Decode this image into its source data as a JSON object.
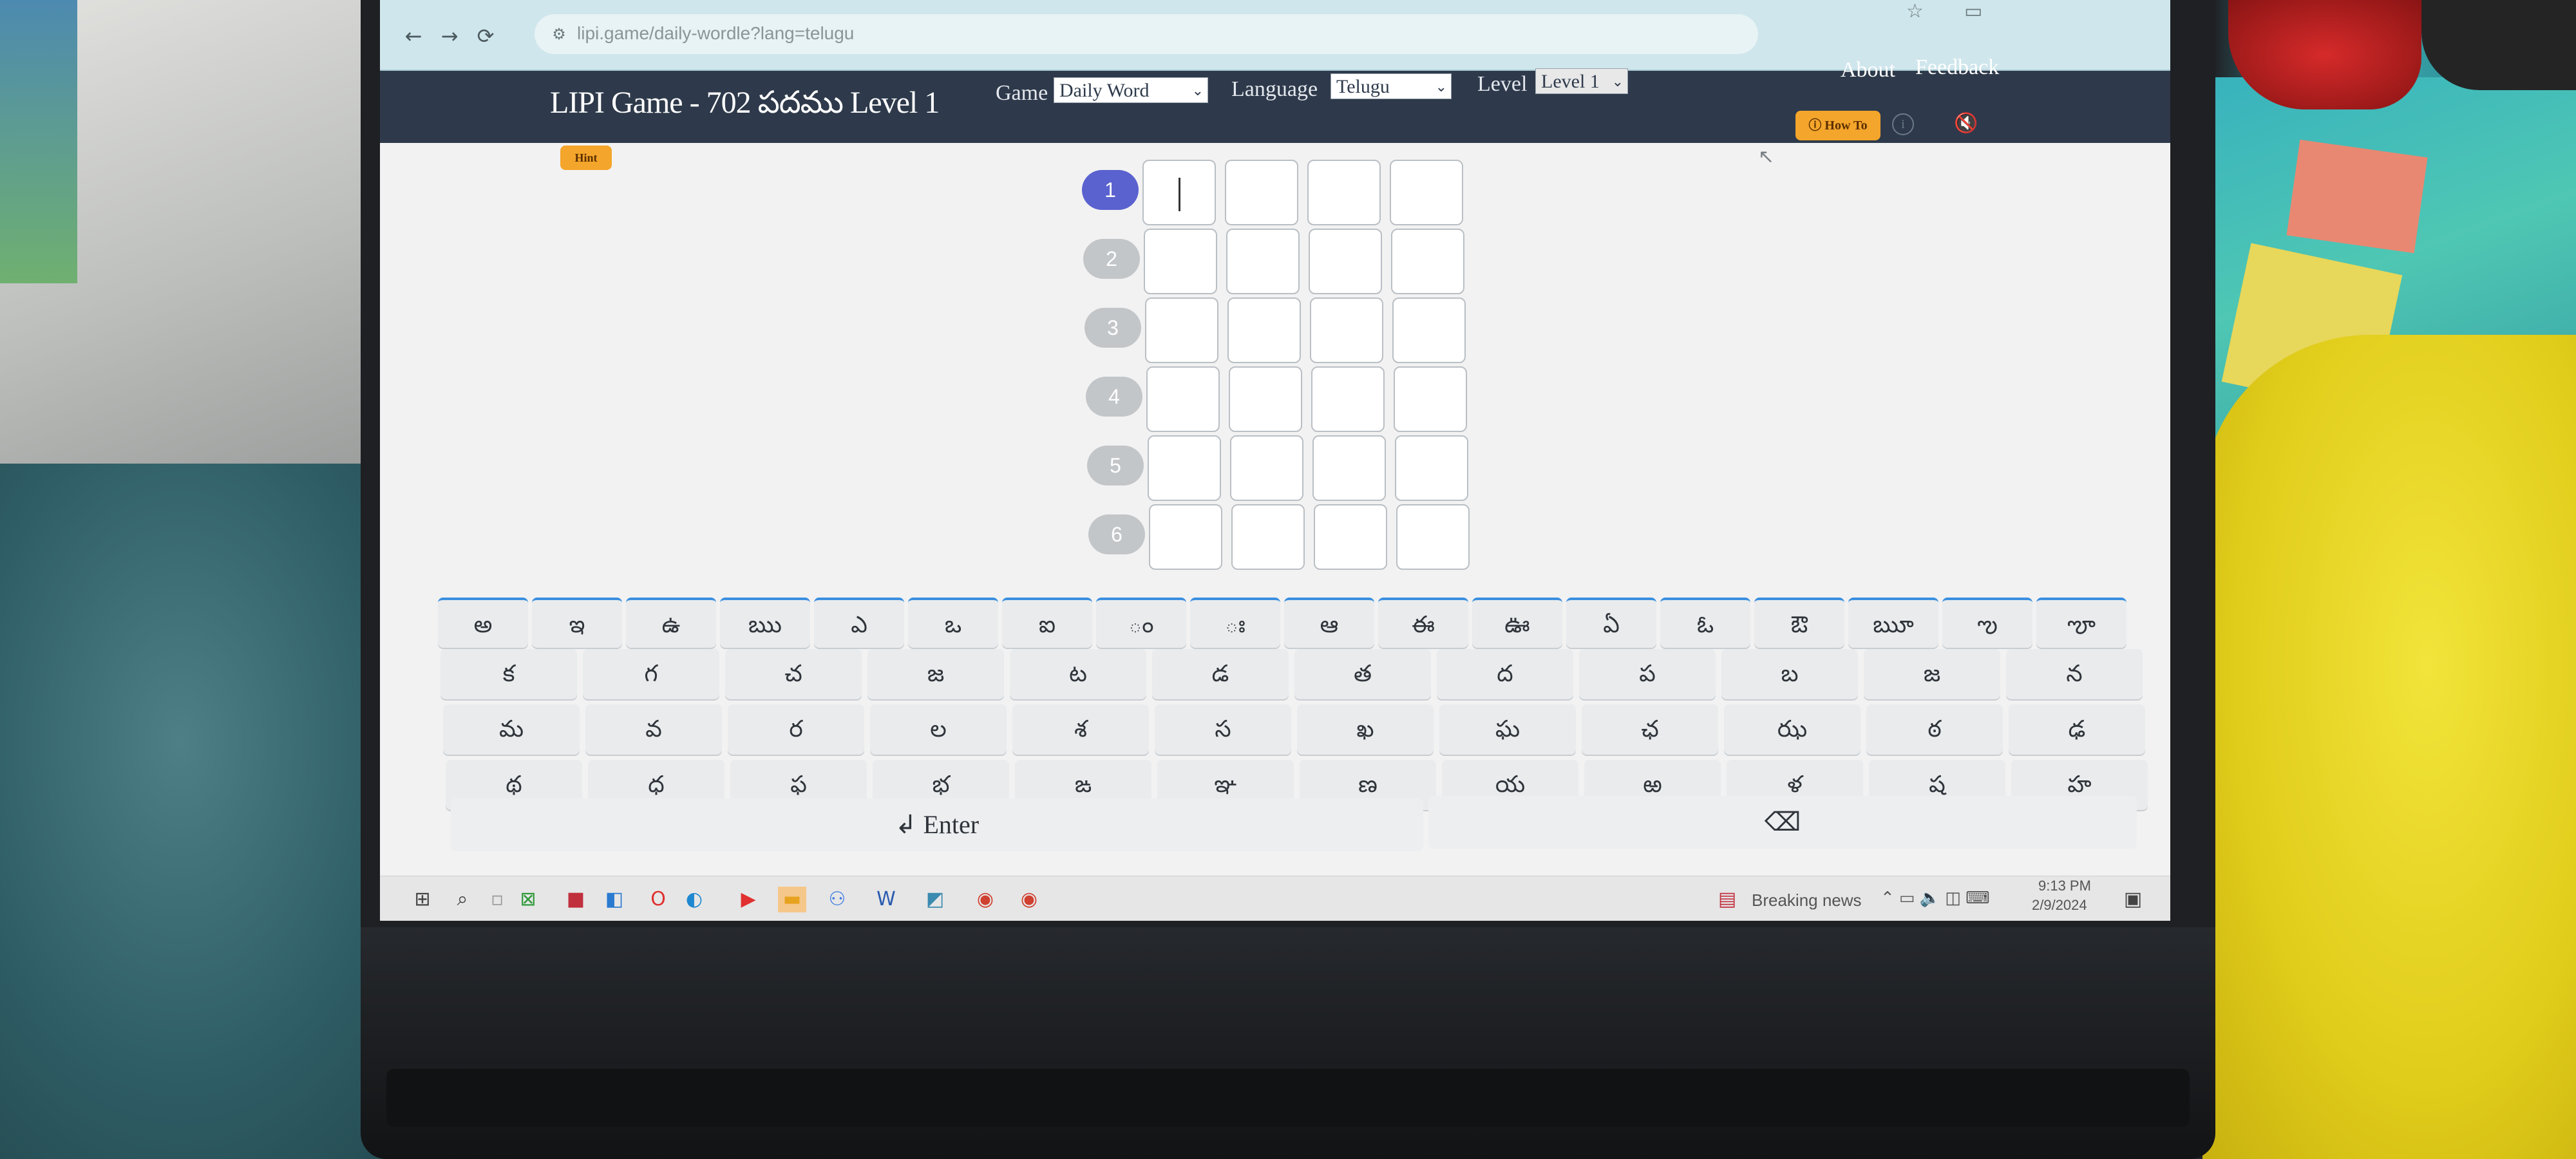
{
  "browser": {
    "url": "lipi.game/daily-wordle?lang=telugu",
    "back_icon": "arrow-left-icon",
    "forward_icon": "arrow-right-icon",
    "reload_icon": "reload-icon"
  },
  "header": {
    "title": "LIPI Game - 702  పదము Level 1",
    "game_label": "Game",
    "game_value": "Daily Word",
    "language_label": "Language",
    "language_value": "Telugu",
    "level_label": "Level",
    "level_value": "Level 1",
    "about": "About",
    "feedback": "Feedback"
  },
  "toolbar": {
    "how_to": "How To",
    "hint": "Hint"
  },
  "board": {
    "rows": [
      "1",
      "2",
      "3",
      "4",
      "5",
      "6"
    ],
    "active_row": "1",
    "columns": 4
  },
  "keyboard": {
    "vowels": [
      "అ",
      "ఇ",
      "ఉ",
      "ఋ",
      "ఎ",
      "ఒ",
      "ఐ",
      "ం",
      "ః",
      "ఆ",
      "ఈ",
      "ఊ",
      "ఏ",
      "ఓ",
      "ఔ",
      "ౠ",
      "ఌ",
      "ౡ"
    ],
    "row2": [
      "క",
      "గ",
      "చ",
      "జ",
      "ట",
      "డ",
      "త",
      "ద",
      "ప",
      "బ",
      "జ",
      "న"
    ],
    "row3": [
      "మ",
      "వ",
      "ర",
      "ల",
      "శ",
      "స",
      "ఖ",
      "ఘ",
      "ఛ",
      "ఝ",
      "ఠ",
      "ఢ"
    ],
    "row4": [
      "థ",
      "ధ",
      "ఫ",
      "భ",
      "ఙ",
      "ఞ",
      "ణ",
      "య",
      "ఱ",
      "ళ",
      "ష",
      "హ"
    ],
    "enter": "↲ Enter",
    "backspace": "⌫"
  },
  "taskbar": {
    "news": "Breaking news",
    "time": "9:13 PM",
    "date": "2/9/2024"
  }
}
